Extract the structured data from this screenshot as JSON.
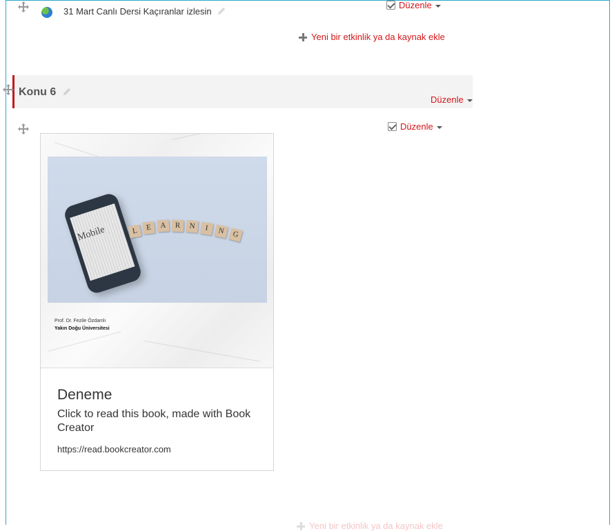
{
  "top_activity": {
    "title": "31 Mart Canlı Dersi Kaçıranlar izlesin",
    "edit_label": "Düzenle",
    "icon": "globe-icon"
  },
  "add_activity": {
    "label": "Yeni bir etkinlik ya da kaynak ekle"
  },
  "section": {
    "title": "Konu 6",
    "edit_label": "Düzenle"
  },
  "book_activity": {
    "edit_label": "Düzenle",
    "cover": {
      "phone_word": "Mobile",
      "tile_letters": [
        "L",
        "E",
        "A",
        "R",
        "N",
        "I",
        "N",
        "G"
      ],
      "author": "Prof. Dr. Fezile Özdamlı",
      "university": "Yakın Doğu Üniversitesi"
    },
    "title": "Deneme",
    "description": "Click to read this book, made with Book Creator",
    "url": "https://read.bookcreator.com"
  },
  "colors": {
    "accent": "#d4161a",
    "frame": "#2aa7c9",
    "section_bar": "#c4161c"
  }
}
